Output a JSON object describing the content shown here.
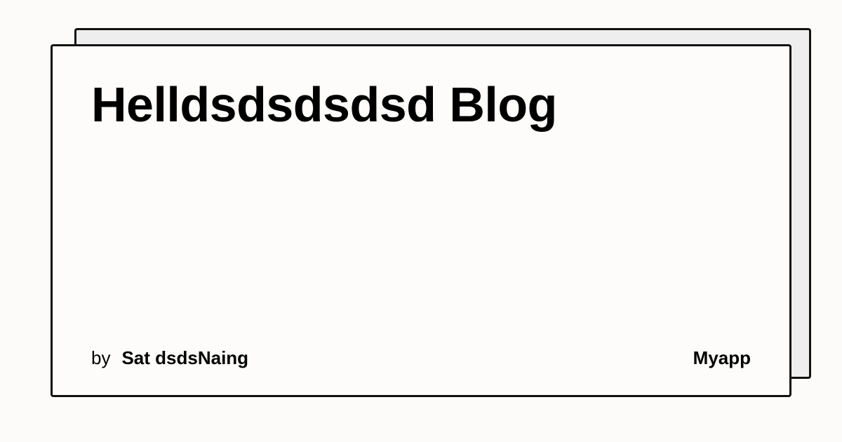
{
  "post": {
    "title": "Helldsdsdsdsd Blog",
    "by_label": "by",
    "author": "Sat dsdsNaing",
    "app_name": "Myapp"
  },
  "colors": {
    "background": "#fcfbf9",
    "card_background": "#fdfcfa",
    "card_shadow": "#eeeeee",
    "border": "#111111",
    "text": "#000000"
  }
}
